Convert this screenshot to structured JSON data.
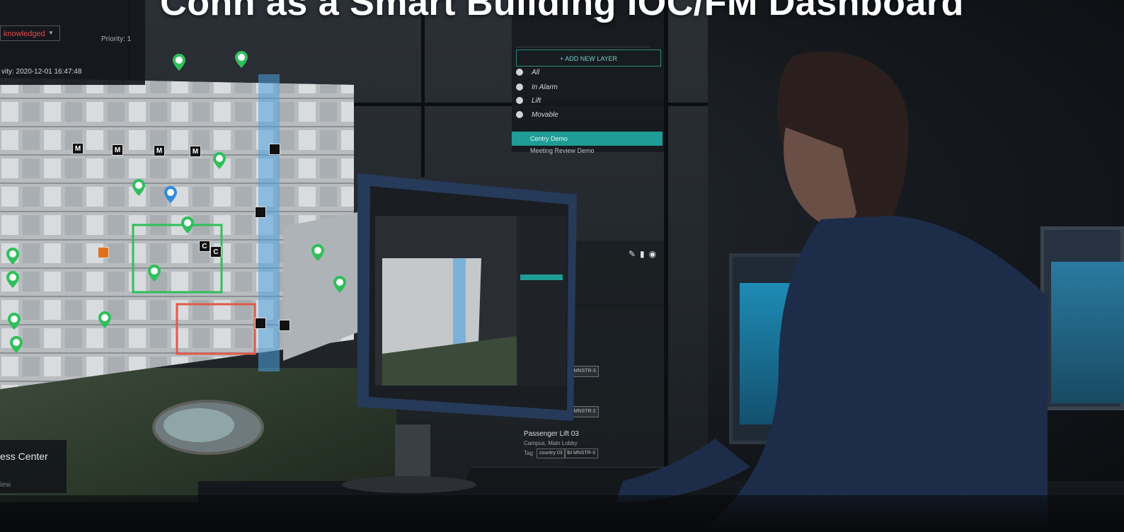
{
  "headline": "Cohn as a Smart Building IOC/FM Dashboard",
  "top_left_panel": {
    "status": "knowledged",
    "priority": "Priority: 1",
    "activity": "vity: 2020-12-01 16:47:48"
  },
  "layer_panel": {
    "add_layer": "+ ADD NEW LAYER",
    "items": [
      "All",
      "In Alarm",
      "Lift",
      "Movable"
    ],
    "selected_item": "Centry Demo",
    "next_item": "Meeting Review Demo"
  },
  "lift_card": {
    "title": "Passenger Lift 03",
    "subtitle": "Campus, Main Lobby",
    "tag_label": "Tag",
    "chips": [
      "country 03",
      "lbl MNSTR-3"
    ]
  },
  "list_tags": [
    "E MNSTR-3",
    "E MNSTR-2"
  ],
  "bottom_left_card": {
    "title": "ess Center",
    "subtitle": "iew"
  },
  "tag_letters": {
    "m": "M",
    "c": "C"
  },
  "colors": {
    "pin_green": "#2fbf5b",
    "pin_blue": "#2f8be0",
    "accent_teal": "#1f9c95",
    "alert_red": "#e04848"
  }
}
